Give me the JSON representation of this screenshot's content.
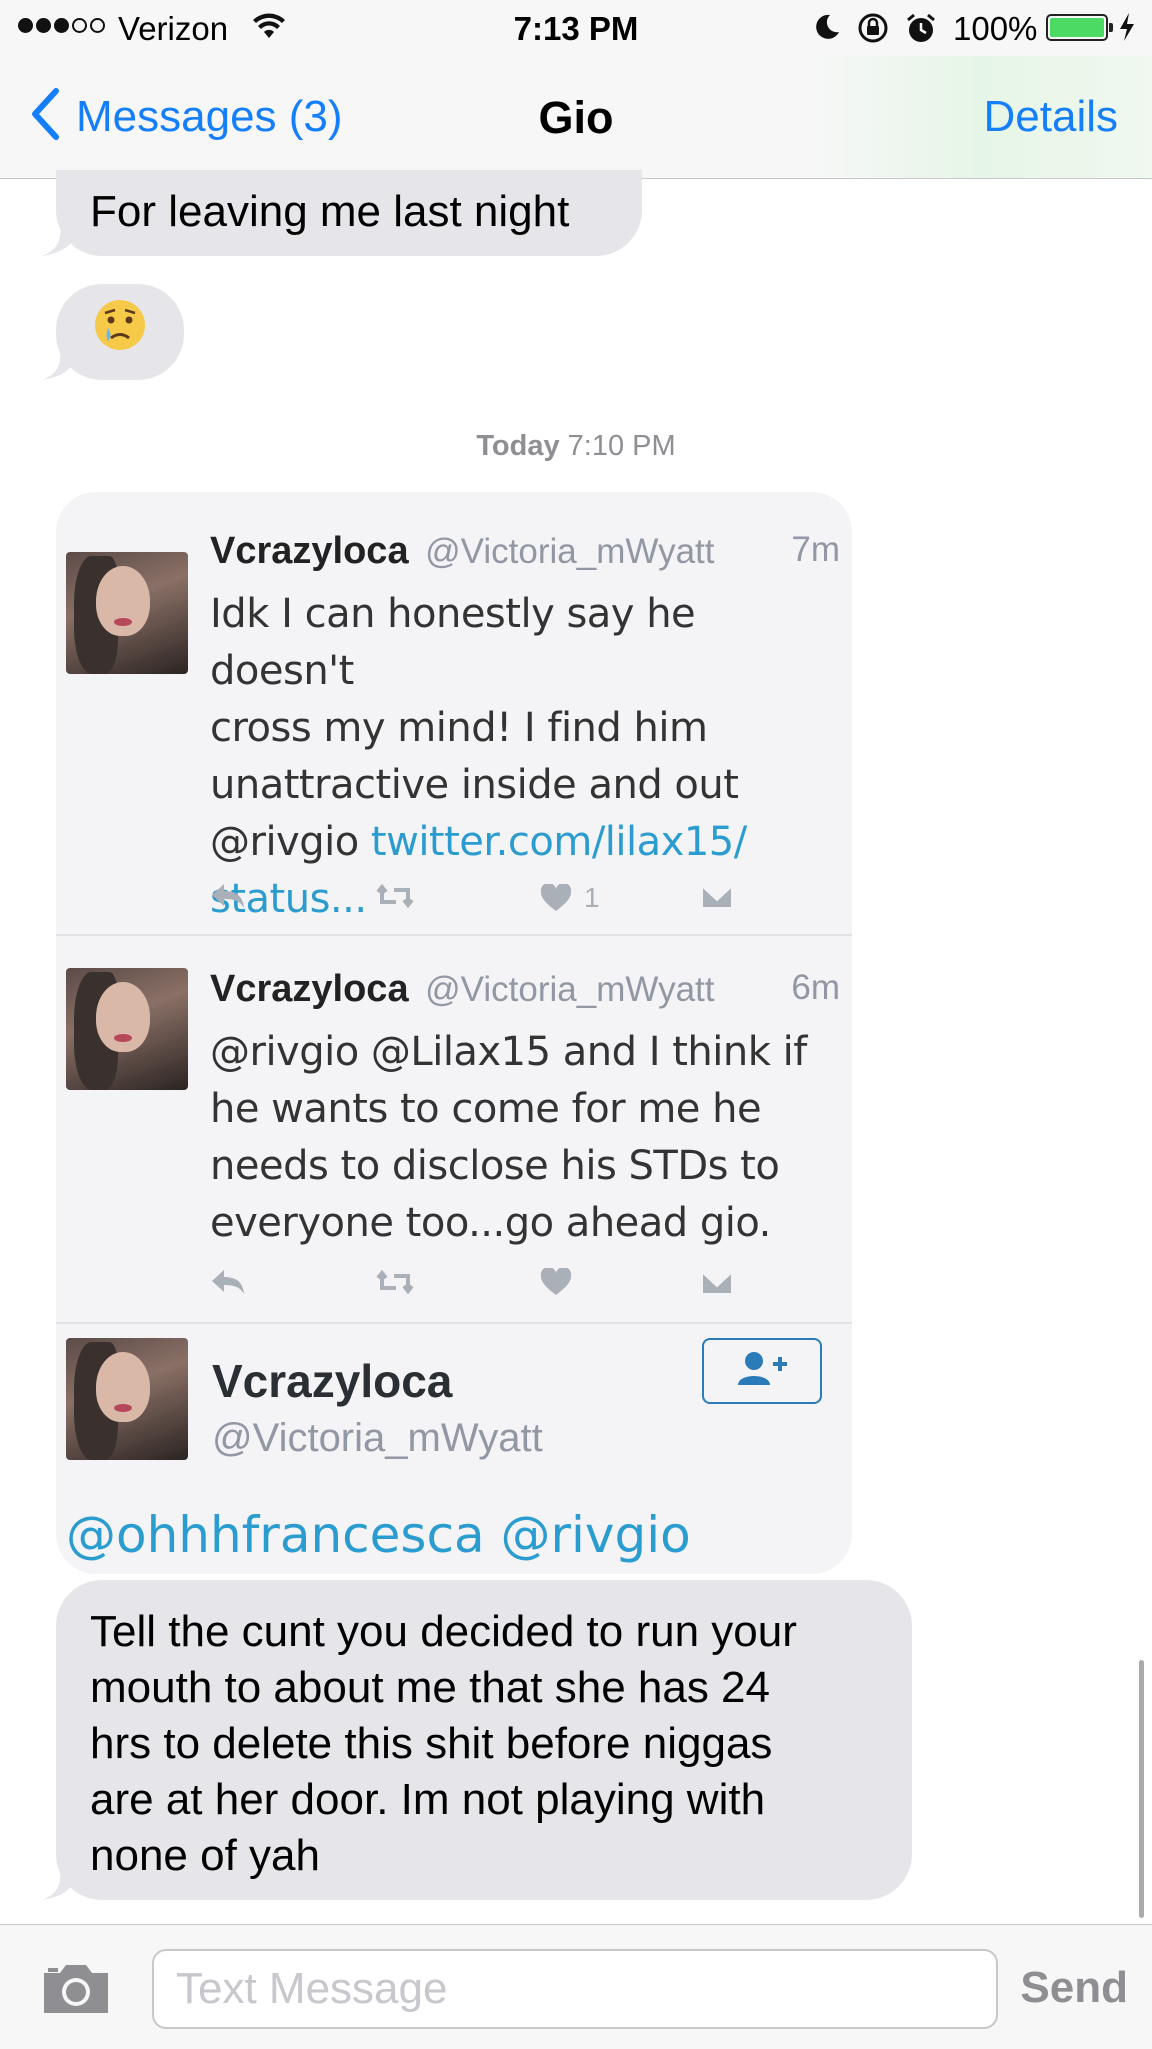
{
  "status_bar": {
    "carrier": "Verizon",
    "time": "7:13 PM",
    "battery_percent": "100%",
    "battery_level": 1.0,
    "signal_bars": 3,
    "signal_bars_total": 5,
    "icons": [
      "wifi-icon",
      "moon-icon",
      "rotation-lock-icon",
      "alarm-icon",
      "battery-icon",
      "charging-bolt-icon"
    ]
  },
  "nav": {
    "back_label": "Messages (3)",
    "title": "Gio",
    "details_label": "Details"
  },
  "messages": {
    "m1": "For leaving me last night",
    "m2": "😢",
    "timestamp_day": "Today",
    "timestamp_time": "7:10 PM",
    "m3_lines": [
      "Tell the cunt you decided to run your",
      "mouth to about me that she has 24",
      "hrs to delete this shit before niggas",
      "are at her door. Im not playing with",
      "none of yah"
    ]
  },
  "screenshot": {
    "tweets": [
      {
        "name": "Vcrazyloca",
        "handle": "@Victoria_mWyatt",
        "ago": "7m",
        "lines": [
          "Idk I can honestly say he doesn't",
          "cross my mind! I find him",
          "unattractive inside and out",
          "@rivgio "
        ],
        "link1": "twitter.com/lilax15/",
        "link2": "status...",
        "likes": "1"
      },
      {
        "name": "Vcrazyloca",
        "handle": "@Victoria_mWyatt",
        "ago": "6m",
        "lines": [
          "@rivgio @Lilax15 and I think if",
          "he wants to come for me he",
          "needs to disclose his STDs to",
          "everyone too...go ahead gio."
        ]
      }
    ],
    "profile": {
      "name": "Vcrazyloca",
      "handle": "@Victoria_mWyatt"
    },
    "mentions": "@ohhhfrancesca @rivgio"
  },
  "composer": {
    "placeholder": "Text Message",
    "send_label": "Send"
  },
  "colors": {
    "ios_blue": "#147efb",
    "bubble_gray": "#e5e5ea",
    "twitter_link": "#2b9ccf",
    "battery_green": "#4cd964"
  }
}
